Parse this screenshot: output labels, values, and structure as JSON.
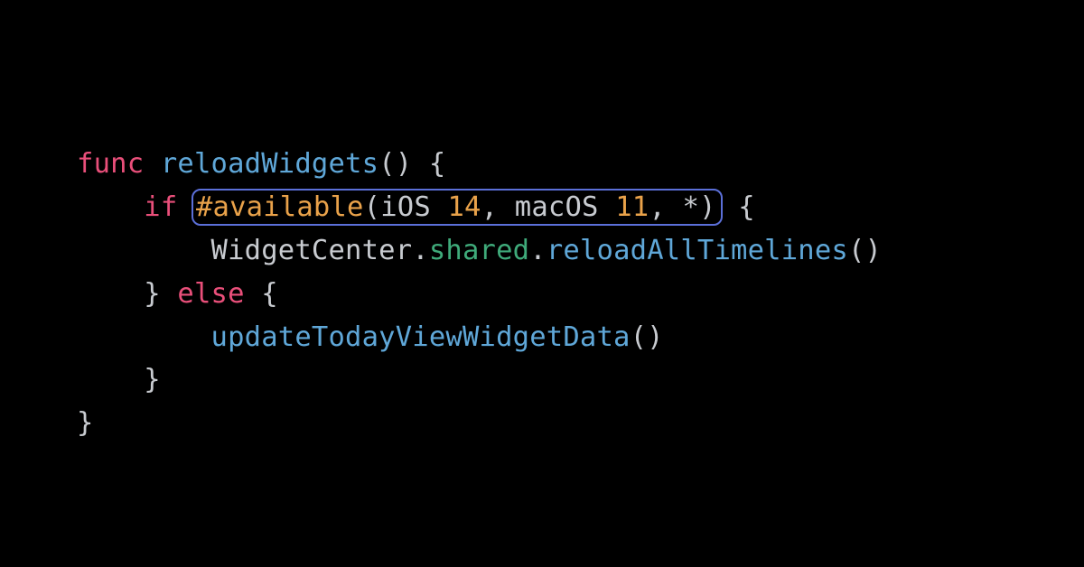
{
  "code": {
    "line1": {
      "kw_func": "func",
      "sp1": " ",
      "name": "reloadWidgets",
      "parens": "()",
      "sp2": " ",
      "brace": "{"
    },
    "line2": {
      "indent": "    ",
      "kw_if": "if",
      "sp1": " ",
      "hash": "#available",
      "open": "(",
      "p1": "iOS",
      "sp2": " ",
      "n1": "14",
      "c1": ",",
      "sp3": " ",
      "p2": "macOS",
      "sp4": " ",
      "n2": "11",
      "c2": ",",
      "sp5": " ",
      "star": "*",
      "close": ")",
      "sp6": " ",
      "brace": "{"
    },
    "line3": {
      "indent": "        ",
      "t1": "WidgetCenter",
      "d1": ".",
      "prop": "shared",
      "d2": ".",
      "fn": "reloadAllTimelines",
      "parens": "()"
    },
    "line4": {
      "indent": "    ",
      "brace1": "}",
      "sp1": " ",
      "kw_else": "else",
      "sp2": " ",
      "brace2": "{"
    },
    "line5": {
      "indent": "        ",
      "fn": "updateTodayViewWidgetData",
      "parens": "()"
    },
    "line6": {
      "indent": "    ",
      "brace": "}"
    },
    "line7": {
      "brace": "}"
    }
  }
}
